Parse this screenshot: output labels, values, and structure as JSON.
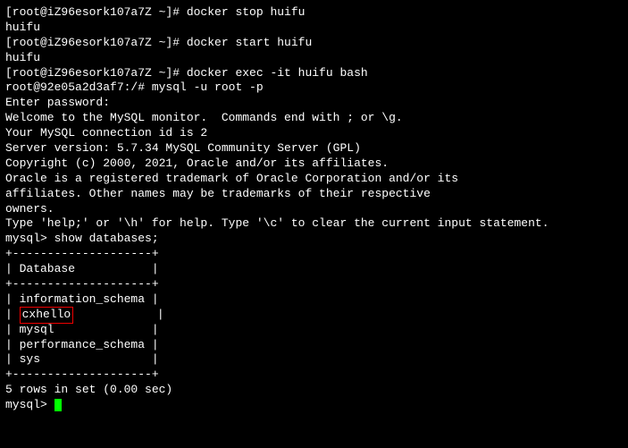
{
  "lines": [
    "[root@iZ96esork107a7Z ~]# docker stop huifu",
    "huifu",
    "[root@iZ96esork107a7Z ~]# docker start huifu",
    "huifu",
    "[root@iZ96esork107a7Z ~]# docker exec -it huifu bash",
    "root@92e05a2d3af7:/# mysql -u root -p",
    "Enter password:",
    "Welcome to the MySQL monitor.  Commands end with ; or \\g.",
    "Your MySQL connection id is 2",
    "Server version: 5.7.34 MySQL Community Server (GPL)",
    "",
    "Copyright (c) 2000, 2021, Oracle and/or its affiliates.",
    "",
    "Oracle is a registered trademark of Oracle Corporation and/or its",
    "affiliates. Other names may be trademarks of their respective",
    "owners.",
    "",
    "Type 'help;' or '\\h' for help. Type '\\c' to clear the current input statement.",
    "",
    "mysql> show databases;",
    "+--------------------+",
    "| Database           |",
    "+--------------------+",
    "| information_schema |"
  ],
  "highlighted_row": {
    "prefix": "| ",
    "db_name": "cxhello",
    "suffix": "            |"
  },
  "lines_after": [
    "| mysql              |",
    "| performance_schema |",
    "| sys                |",
    "+--------------------+",
    "5 rows in set (0.00 sec)",
    "",
    "mysql> "
  ]
}
